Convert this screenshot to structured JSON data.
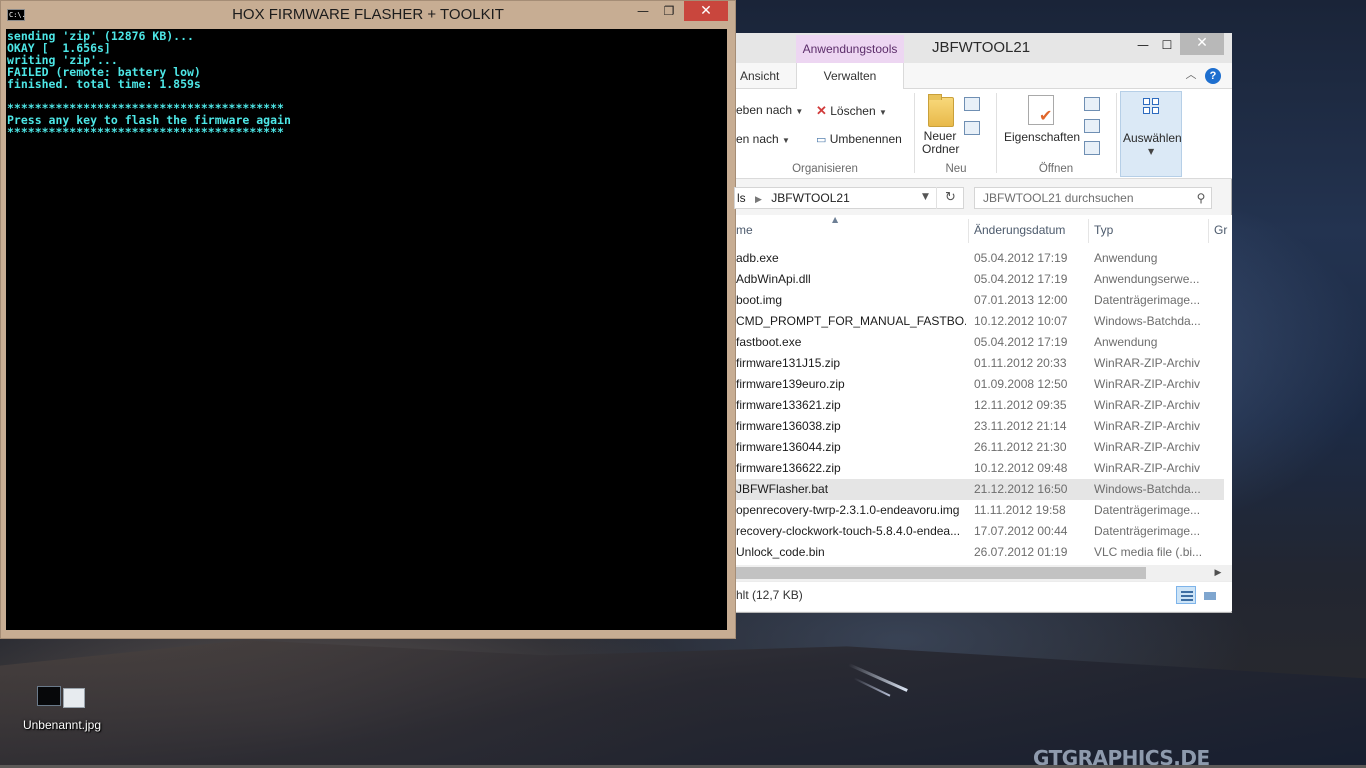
{
  "desktop": {
    "watermark": "GTGRAPHICS.DE",
    "icon_label": "Unbenannt.jpg"
  },
  "console": {
    "title": "HOX FIRMWARE FLASHER + TOOLKIT",
    "app_icon_text": "C:\\.",
    "lines": [
      "sending 'zip' (12876 KB)...",
      "OKAY [  1.656s]",
      "writing 'zip'...",
      "FAILED (remote: battery low)",
      "finished. total time: 1.859s",
      "",
      "****************************************",
      "Press any key to flash the firmware again",
      "****************************************"
    ],
    "text_color": "#4de6e6"
  },
  "explorer": {
    "title": "JBFWTOOL21",
    "context_tab": "Anwendungstools",
    "tabs": {
      "ansicht": "Ansicht",
      "verwalten": "Verwalten"
    },
    "ribbon": {
      "verschieben": "eben nach",
      "kopieren": "en nach",
      "loeschen": "Löschen",
      "umbenennen": "Umbenennen",
      "neuer_ordner_1": "Neuer",
      "neuer_ordner_2": "Ordner",
      "eigenschaften": "Eigenschaften",
      "auswaehlen": "Auswählen",
      "group_organisieren": "Organisieren",
      "group_neu": "Neu",
      "group_oeffnen": "Öffnen"
    },
    "address": {
      "prefix": "ls",
      "folder": "JBFWTOOL21"
    },
    "search_placeholder": "JBFWTOOL21 durchsuchen",
    "columns": {
      "name": "me",
      "date": "Änderungsdatum",
      "type": "Typ",
      "size": "Gr"
    },
    "files": [
      {
        "name": "adb.exe",
        "date": "05.04.2012 17:19",
        "type": "Anwendung"
      },
      {
        "name": "AdbWinApi.dll",
        "date": "05.04.2012 17:19",
        "type": "Anwendungserwe..."
      },
      {
        "name": "boot.img",
        "date": "07.01.2013 12:00",
        "type": "Datenträgerimage..."
      },
      {
        "name": "CMD_PROMPT_FOR_MANUAL_FASTBO...",
        "date": "10.12.2012 10:07",
        "type": "Windows-Batchda..."
      },
      {
        "name": "fastboot.exe",
        "date": "05.04.2012 17:19",
        "type": "Anwendung"
      },
      {
        "name": "firmware131J15.zip",
        "date": "01.11.2012 20:33",
        "type": "WinRAR-ZIP-Archiv"
      },
      {
        "name": "firmware139euro.zip",
        "date": "01.09.2008 12:50",
        "type": "WinRAR-ZIP-Archiv"
      },
      {
        "name": "firmware133621.zip",
        "date": "12.11.2012 09:35",
        "type": "WinRAR-ZIP-Archiv"
      },
      {
        "name": "firmware136038.zip",
        "date": "23.11.2012 21:14",
        "type": "WinRAR-ZIP-Archiv"
      },
      {
        "name": "firmware136044.zip",
        "date": "26.11.2012 21:30",
        "type": "WinRAR-ZIP-Archiv"
      },
      {
        "name": "firmware136622.zip",
        "date": "10.12.2012 09:48",
        "type": "WinRAR-ZIP-Archiv"
      },
      {
        "name": "JBFWFlasher.bat",
        "date": "21.12.2012 16:50",
        "type": "Windows-Batchda..."
      },
      {
        "name": "openrecovery-twrp-2.3.1.0-endeavoru.img",
        "date": "11.11.2012 19:58",
        "type": "Datenträgerimage..."
      },
      {
        "name": "recovery-clockwork-touch-5.8.4.0-endea...",
        "date": "17.07.2012 00:44",
        "type": "Datenträgerimage..."
      },
      {
        "name": "Unlock_code.bin",
        "date": "26.07.2012 01:19",
        "type": "VLC media file (.bi..."
      }
    ],
    "selected_row": 11,
    "status": "hlt (12,7 KB)"
  }
}
